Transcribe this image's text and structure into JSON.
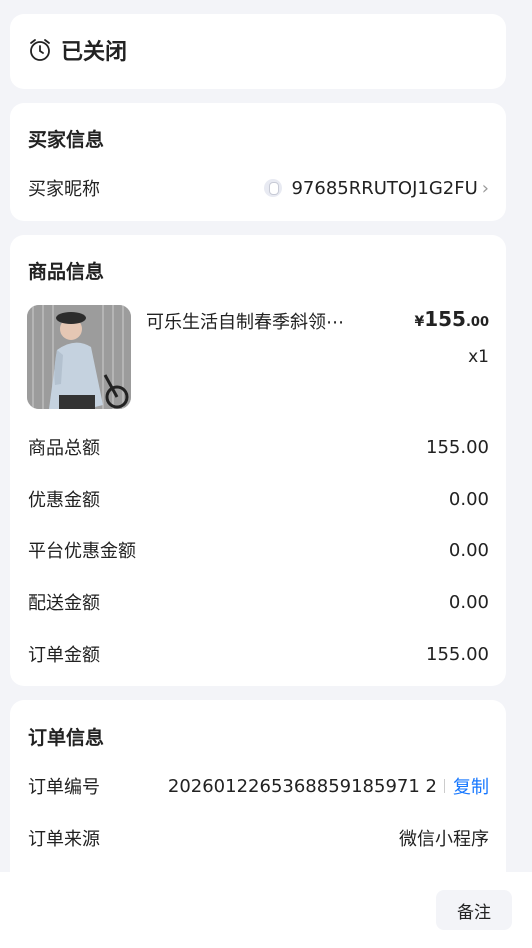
{
  "status": {
    "icon": "alarm-clock-icon",
    "text": "已关闭"
  },
  "buyer": {
    "title": "买家信息",
    "nickname_label": "买家昵称",
    "nickname_value": "97685RRUTOJ1G2FU"
  },
  "goods": {
    "title": "商品信息",
    "item": {
      "name": "可乐生活自制春季斜领⋯",
      "price_symbol": "¥",
      "price_int": "155",
      "price_dec": ".00",
      "qty": "x1"
    },
    "rows": [
      {
        "label": "商品总额",
        "value": "155.00"
      },
      {
        "label": "优惠金额",
        "value": "0.00"
      },
      {
        "label": "平台优惠金额",
        "value": "0.00"
      },
      {
        "label": "配送金额",
        "value": "0.00"
      },
      {
        "label": "订单金额",
        "value": "155.00"
      }
    ]
  },
  "order": {
    "title": "订单信息",
    "number_label": "订单编号",
    "number_value": "2026012265368859185971 2",
    "copy_label": "复制",
    "source_label": "订单来源",
    "source_value": "微信小程序"
  },
  "bottom": {
    "remark_label": "备注"
  },
  "colors": {
    "background": "#f3f4f8",
    "accent": "#1677ff"
  }
}
